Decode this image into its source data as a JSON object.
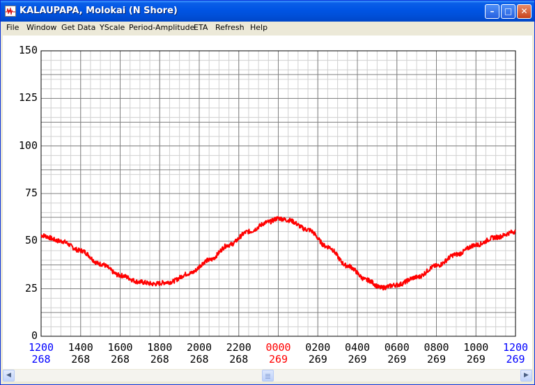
{
  "window": {
    "title": "KALAUPAPA, Molokai (N Shore)"
  },
  "titlebar_buttons": [
    {
      "name": "minimize-button",
      "icon": "minimize-icon",
      "glyph": "–"
    },
    {
      "name": "maximize-button",
      "icon": "maximize-icon",
      "glyph": "□"
    },
    {
      "name": "close-button",
      "icon": "close-icon",
      "glyph": "✕"
    }
  ],
  "menu": [
    "File",
    "Window",
    "Get Data",
    "YScale",
    "Period-Amplitude",
    "ETA",
    "Refresh",
    "Help"
  ],
  "scrollbar": {
    "left_glyph": "◀",
    "right_glyph": "▶"
  },
  "colors": {
    "trace": "#ff0000",
    "current_day": "#ff0000",
    "edge_labels": "#0000ff",
    "grid_major": "#808080",
    "grid_minor": "#d0d0d0"
  },
  "chart_data": {
    "type": "line",
    "ylim": [
      0,
      150
    ],
    "yticks": [
      0,
      25,
      50,
      75,
      100,
      125,
      150
    ],
    "xlim": [
      0,
      24
    ],
    "x_tick_times": [
      "1200",
      "1400",
      "1600",
      "1800",
      "2000",
      "2200",
      "0000",
      "0200",
      "0400",
      "0600",
      "0800",
      "1000",
      "1200"
    ],
    "x_tick_days": [
      "268",
      "268",
      "268",
      "268",
      "268",
      "268",
      "269",
      "269",
      "269",
      "269",
      "269",
      "269",
      "269"
    ],
    "x_tick_colors": [
      "blue",
      "black",
      "black",
      "black",
      "black",
      "black",
      "red",
      "black",
      "black",
      "black",
      "black",
      "black",
      "blue"
    ],
    "grid": true,
    "series": [
      {
        "color": "#ff0000",
        "x": [
          0,
          1,
          2,
          3,
          4,
          5,
          5.7,
          6.5,
          7.5,
          8.5,
          9.5,
          10.5,
          11.5,
          12,
          12.5,
          13.5,
          14.5,
          15.5,
          16.5,
          17.2,
          18,
          19,
          20,
          21,
          22,
          23,
          24
        ],
        "y": [
          53,
          50,
          45,
          38,
          32,
          28.5,
          27.5,
          28.5,
          33,
          40,
          48,
          55,
          60,
          62,
          61,
          56,
          47,
          37,
          29.5,
          25.5,
          27,
          31,
          37,
          43,
          48,
          52,
          55
        ]
      }
    ]
  }
}
